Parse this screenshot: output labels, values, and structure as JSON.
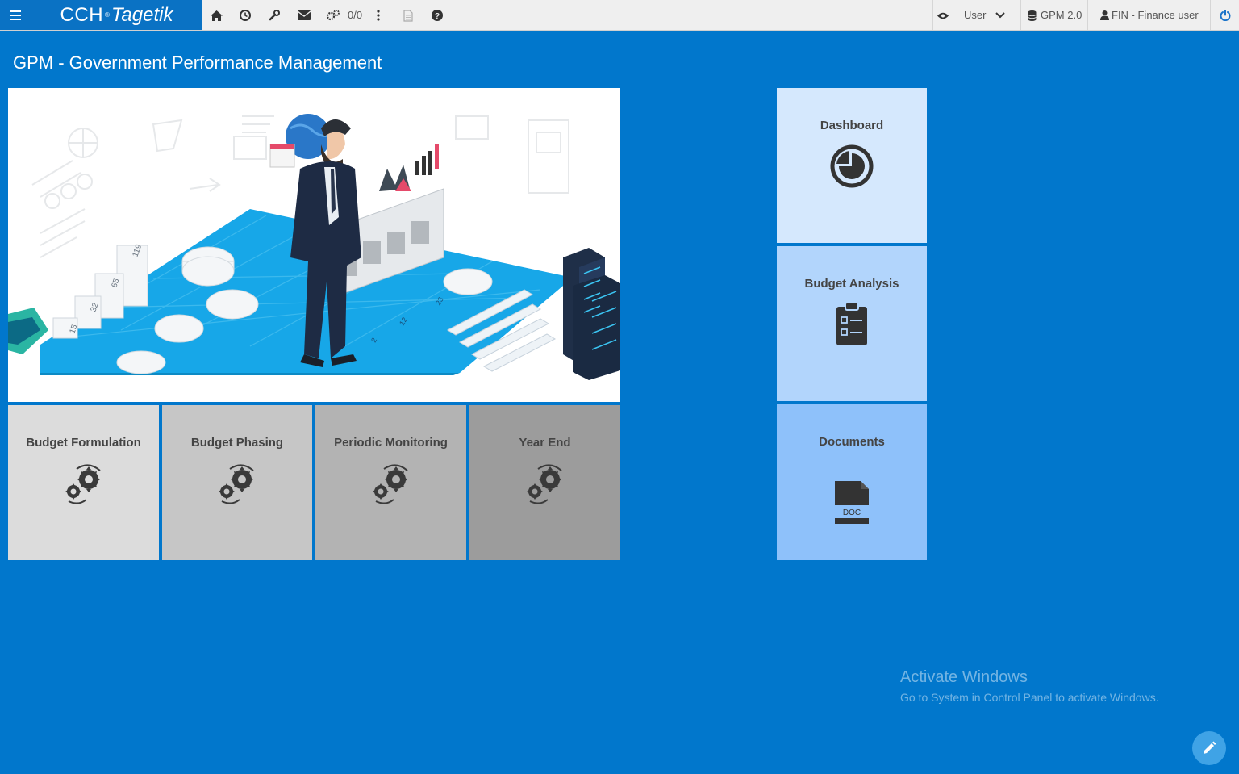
{
  "brand": {
    "name_a": "CCH",
    "name_b": "Tagetik",
    "reg": "®"
  },
  "toolbar": {
    "counter": "0/0",
    "view_mode": "User",
    "model": "GPM 2.0",
    "user": "FIN - Finance user"
  },
  "page": {
    "title": "GPM - Government Performance Management"
  },
  "tiles": {
    "budget_formulation": "Budget Formulation",
    "budget_phasing": "Budget Phasing",
    "periodic_monitoring": "Periodic Monitoring",
    "year_end": "Year End",
    "dashboard": "Dashboard",
    "budget_analysis": "Budget Analysis",
    "documents": "Documents",
    "doc_icon_text": "DOC"
  },
  "hero": {
    "labels": [
      "119",
      "65",
      "32",
      "15",
      "23",
      "12",
      "2"
    ]
  },
  "watermark": {
    "line1": "Activate Windows",
    "line2": "Go to System in Control Panel to activate Windows."
  },
  "colors": {
    "background": "#0177cc",
    "brand": "#0a72c4",
    "tile_light": "#dcdcdc",
    "tile_mid": "#c6c6c6",
    "tile_dark": "#b3b3b3",
    "tile_darker": "#9c9c9c",
    "tile_blue1": "#d5e8fd",
    "tile_blue2": "#b2d5fc",
    "tile_blue3": "#8ec1fa"
  }
}
